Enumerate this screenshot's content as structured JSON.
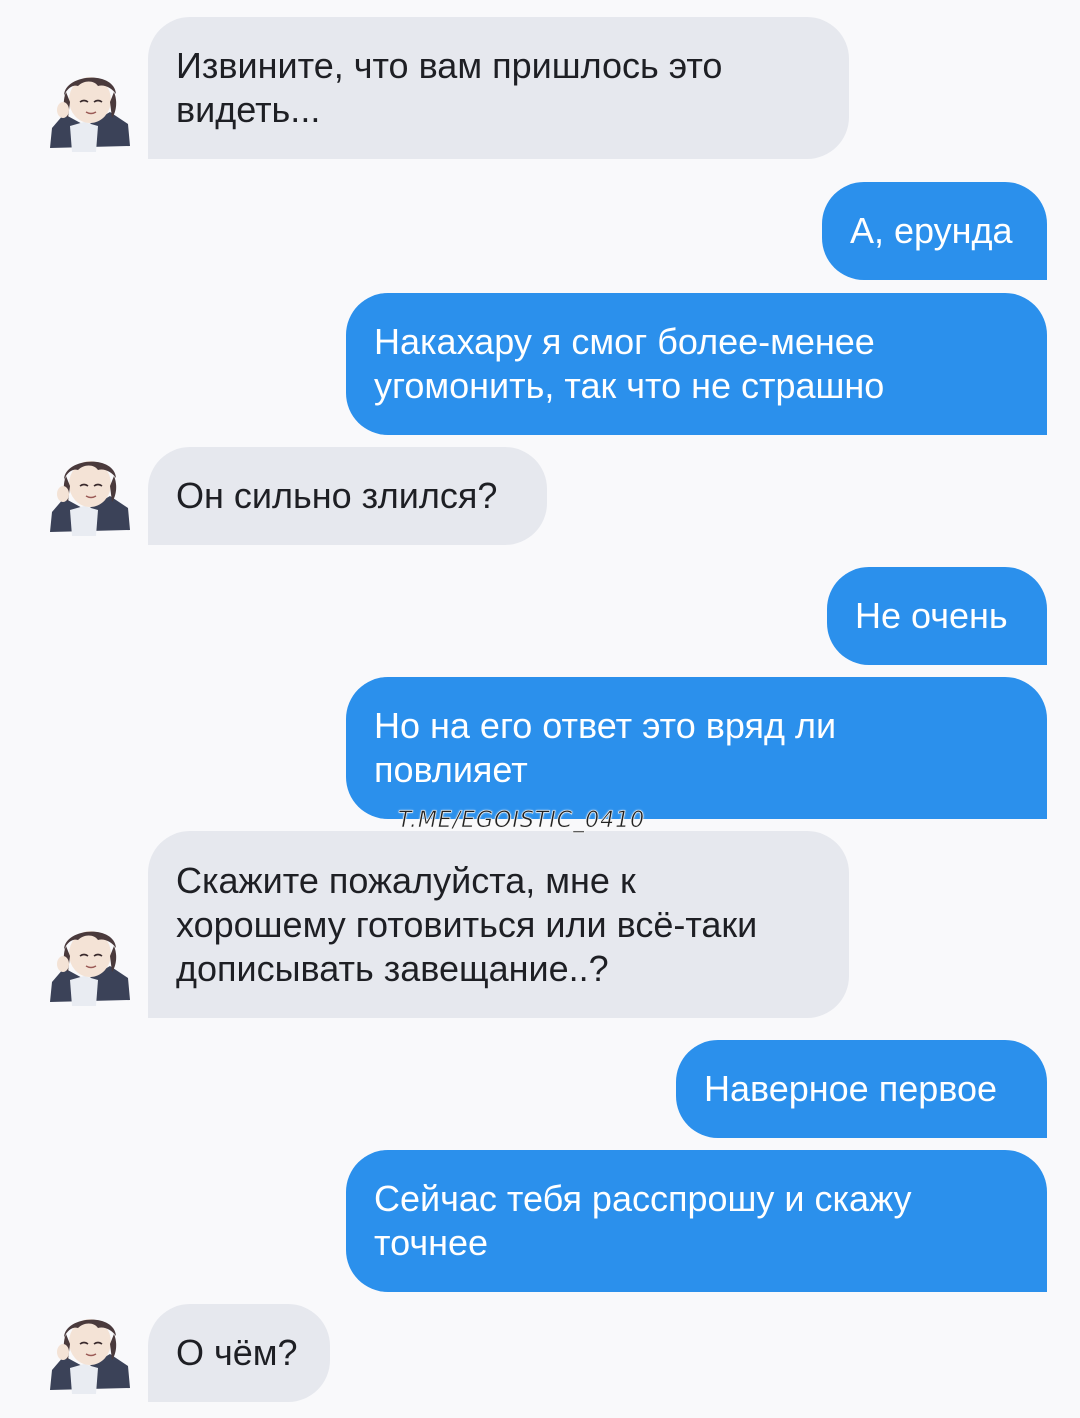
{
  "messages": [
    {
      "side": "in",
      "text": "Извините, что вам пришлось это\nвидеть..."
    },
    {
      "side": "out",
      "text": "А, ерунда"
    },
    {
      "side": "out",
      "text": "Накахару я смог более-менее\nугомонить, так что не страшно"
    },
    {
      "side": "in",
      "text": "Он сильно злился?"
    },
    {
      "side": "out",
      "text": "Не очень"
    },
    {
      "side": "out",
      "text": "Но на его ответ это вряд ли\nповлияет"
    },
    {
      "side": "in",
      "text": "Скажите пожалуйста, мне к\nхорошему готовиться или всё-таки\nдописывать завещание..?"
    },
    {
      "side": "out",
      "text": "Наверное первое"
    },
    {
      "side": "out",
      "text": "Сейчас тебя расспрошу и скажу\nточнее"
    },
    {
      "side": "in",
      "text": "О чём?"
    }
  ],
  "watermark": "T.ME/EGOISTIC_0410",
  "colors": {
    "incoming_bubble": "#e6e8ee",
    "outgoing_bubble": "#2b90ec",
    "background": "#f9f9fb"
  },
  "icons": {
    "contact_avatar": "avatar"
  }
}
